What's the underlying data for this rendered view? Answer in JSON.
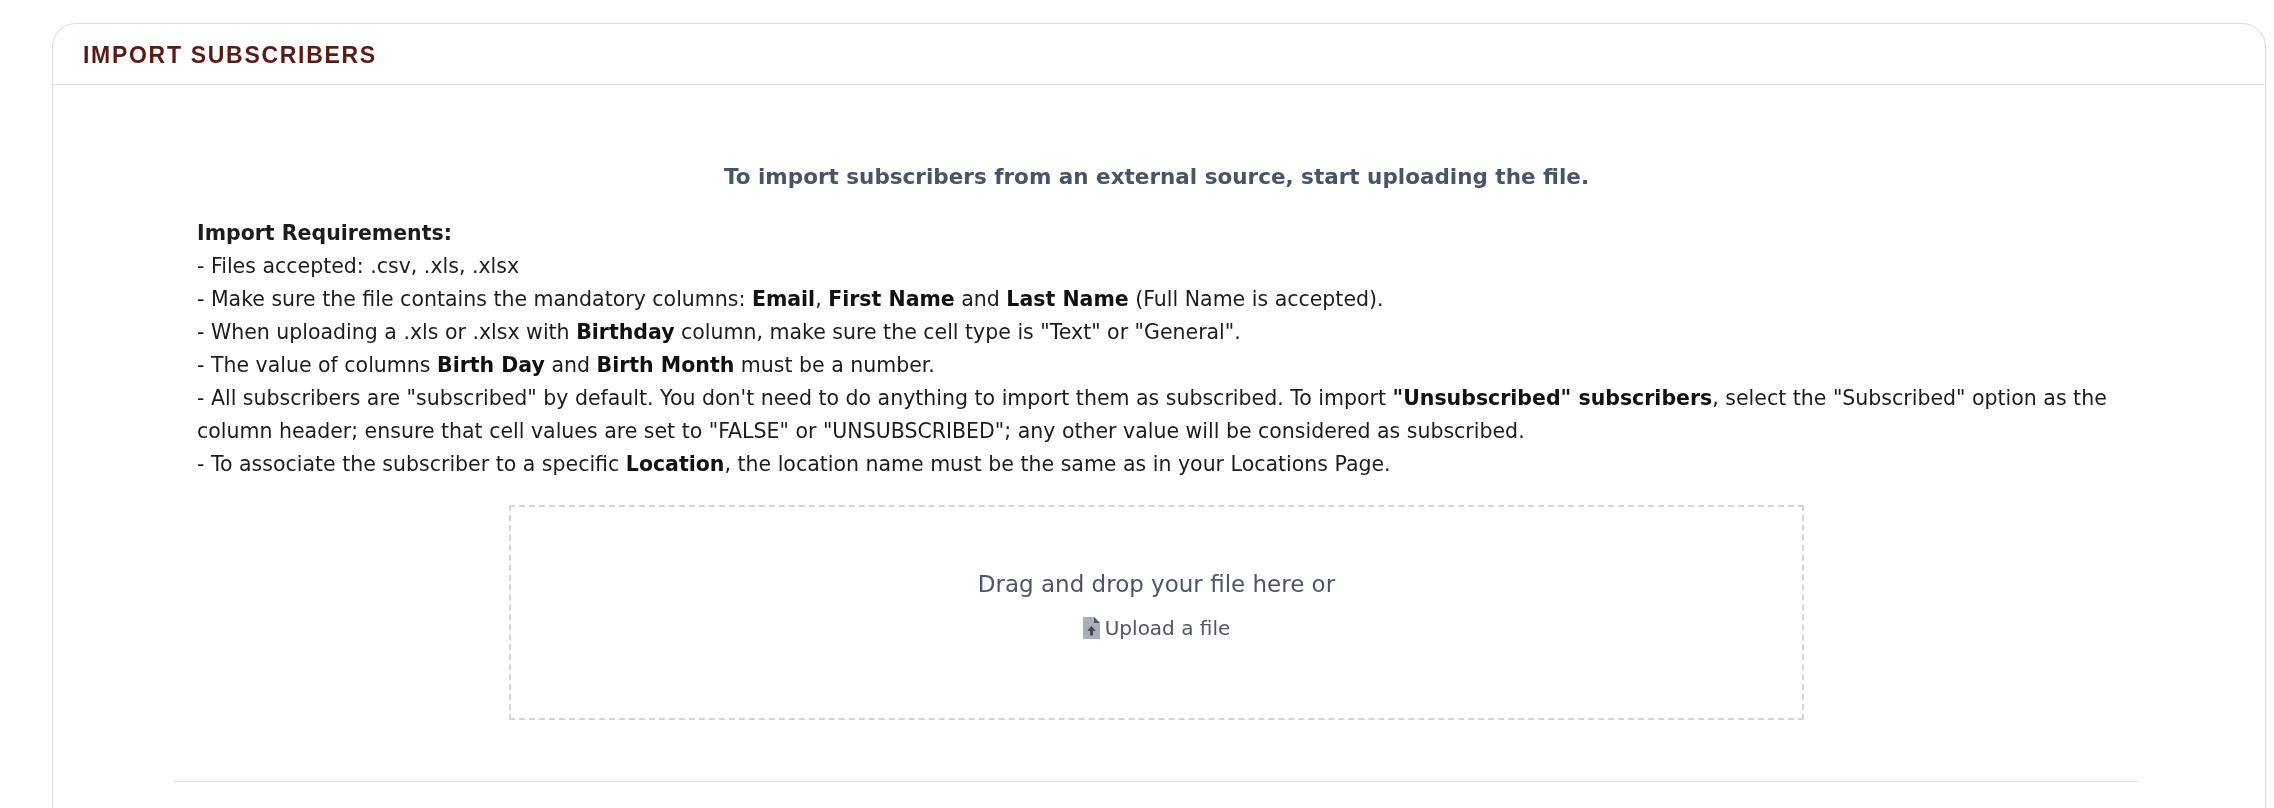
{
  "panel": {
    "title": "IMPORT SUBSCRIBERS"
  },
  "intro": "To import subscribers from an external source, start uploading the file.",
  "requirements": {
    "heading": "Import Requirements:",
    "items": [
      "- Files accepted: .csv, .xls, .xlsx",
      "- Make sure the file contains the mandatory columns: **Email**, **First Name** and **Last Name** (Full Name is accepted).",
      "- When uploading a .xls or .xlsx with **Birthday** column, make sure the cell type is \"Text\" or \"General\".",
      "- The value of columns **Birth Day** and **Birth Month** must be a number.",
      "- All subscribers are \"subscribed\" by default. You don't need to do anything to import them as subscribed. To import **\"Unsubscribed\" subscribers**, select the \"Subscribed\" option as the column header; ensure that cell values are set to \"FALSE\" or \"UNSUBSCRIBED\"; any other value will be considered as subscribed.",
      "- To associate the subscriber to a specific **Location**, the location name must be the same as in your Locations Page."
    ]
  },
  "dropzone": {
    "prompt": "Drag and drop your file here or",
    "upload_link": "Upload a file"
  }
}
